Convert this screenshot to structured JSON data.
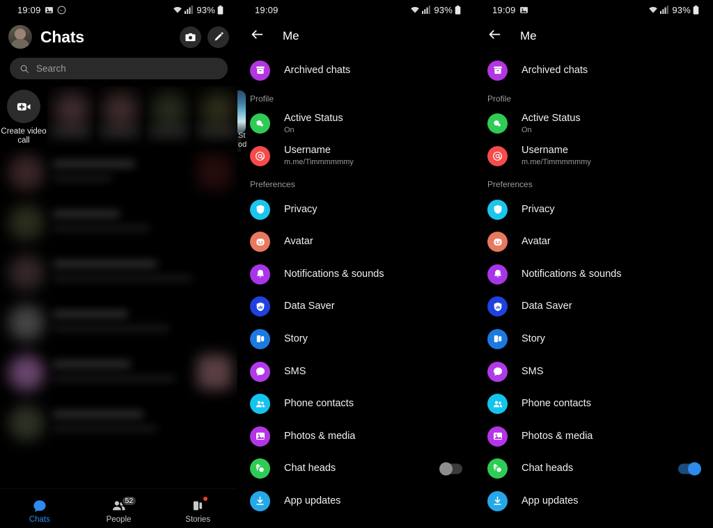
{
  "statusbar": {
    "time": "19:09",
    "battery_pct": "93%",
    "icons_left_p1": [
      "image-icon",
      "messenger-icon"
    ],
    "icons_left_p2": [],
    "icons_left_p3": [
      "image-icon"
    ],
    "icons_right": [
      "wifi-icon",
      "cellular-icon",
      "battery-icon"
    ]
  },
  "panel1": {
    "title": "Chats",
    "avatar_name": "profile-avatar",
    "header_buttons": [
      {
        "name": "camera-button",
        "icon": "camera-icon"
      },
      {
        "name": "compose-button",
        "icon": "pencil-icon"
      }
    ],
    "search": {
      "placeholder": "Search",
      "icon": "search-icon"
    },
    "stories": {
      "create_video_call_label": "Create video call",
      "create_video_call_icon": "video-plus-icon",
      "blurred_story_colors": [
        "#6b4a4f",
        "#6a4a4a",
        "#3f4a32",
        "#4d4a2c"
      ],
      "last_story_line1": "St",
      "last_story_line2": "od"
    },
    "chat_rows": [
      {
        "avatar_color": "#6a4547",
        "thumb_color": "#4a1618",
        "l1w": 118,
        "l2w": 86,
        "thumb": true
      },
      {
        "avatar_color": "#4f5236",
        "thumb_color": "#4a3a12",
        "l1w": 96,
        "l2w": 140,
        "thumb": false
      },
      {
        "avatar_color": "#5e4749",
        "thumb_color": "#1d2a3e",
        "l1w": 150,
        "l2w": 200,
        "thumb": false
      },
      {
        "avatar_color": "#7e7e7e",
        "thumb_color": "#2a2a2a",
        "l1w": 108,
        "l2w": 168,
        "thumb": false
      },
      {
        "avatar_color": "#c07ec6",
        "thumb_color": "#b37f86",
        "l1w": 112,
        "l2w": 176,
        "thumb": true
      },
      {
        "avatar_color": "#525a43",
        "thumb_color": "#1a1a1a",
        "l1w": 130,
        "l2w": 150,
        "thumb": false
      }
    ],
    "bottom_nav": [
      {
        "label": "Chats",
        "icon": "chat-bubble-icon",
        "active": true,
        "badge": null,
        "dot": false
      },
      {
        "label": "People",
        "icon": "people-icon",
        "active": false,
        "badge": "52",
        "dot": false
      },
      {
        "label": "Stories",
        "icon": "stories-icon",
        "active": false,
        "badge": null,
        "dot": true
      }
    ]
  },
  "me_screen": {
    "back_icon": "back-arrow-icon",
    "title": "Me",
    "archived": {
      "label": "Archived chats",
      "icon": "archive-icon",
      "color": "#b336e0"
    },
    "profile_header": "Profile",
    "profile_items": [
      {
        "label": "Active Status",
        "sub": "On",
        "icon": "active-status-icon",
        "color": "#2ecc55"
      },
      {
        "label": "Username",
        "sub": "m.me/Timmmmmmy",
        "icon": "at-sign-icon",
        "color": "#f54b4b"
      }
    ],
    "preferences_header": "Preferences",
    "preference_items": [
      {
        "label": "Privacy",
        "icon": "shield-icon",
        "color": "#1bc6ee",
        "toggle": null
      },
      {
        "label": "Avatar",
        "icon": "avatar-face-icon",
        "color": "#e8795f",
        "toggle": null
      },
      {
        "label": "Notifications & sounds",
        "icon": "bell-icon",
        "color": "#a935e8",
        "toggle": null
      },
      {
        "label": "Data Saver",
        "icon": "data-saver-icon",
        "color": "#2040e0",
        "toggle": null
      },
      {
        "label": "Story",
        "icon": "story-icon",
        "color": "#1b7ae0",
        "toggle": null
      },
      {
        "label": "SMS",
        "icon": "sms-bubble-icon",
        "color": "#b13ae8",
        "toggle": null
      },
      {
        "label": "Phone contacts",
        "icon": "contacts-icon",
        "color": "#14c4ee",
        "toggle": null
      },
      {
        "label": "Photos & media",
        "icon": "photo-icon",
        "color": "#b435e8",
        "toggle": null
      },
      {
        "label": "Chat heads",
        "icon": "chat-heads-icon",
        "color": "#2ecc55",
        "toggle": "off"
      },
      {
        "label": "App updates",
        "icon": "download-icon",
        "color": "#26a8e8",
        "toggle": null
      }
    ],
    "chat_heads_toggle_panel2": "off",
    "chat_heads_toggle_panel3": "on"
  },
  "colors": {
    "background": "#000000",
    "accent_blue": "#2e8aec",
    "badge_red": "#f0412b",
    "text_primary": "#f0f0f0",
    "text_secondary": "#9a9a9a"
  }
}
